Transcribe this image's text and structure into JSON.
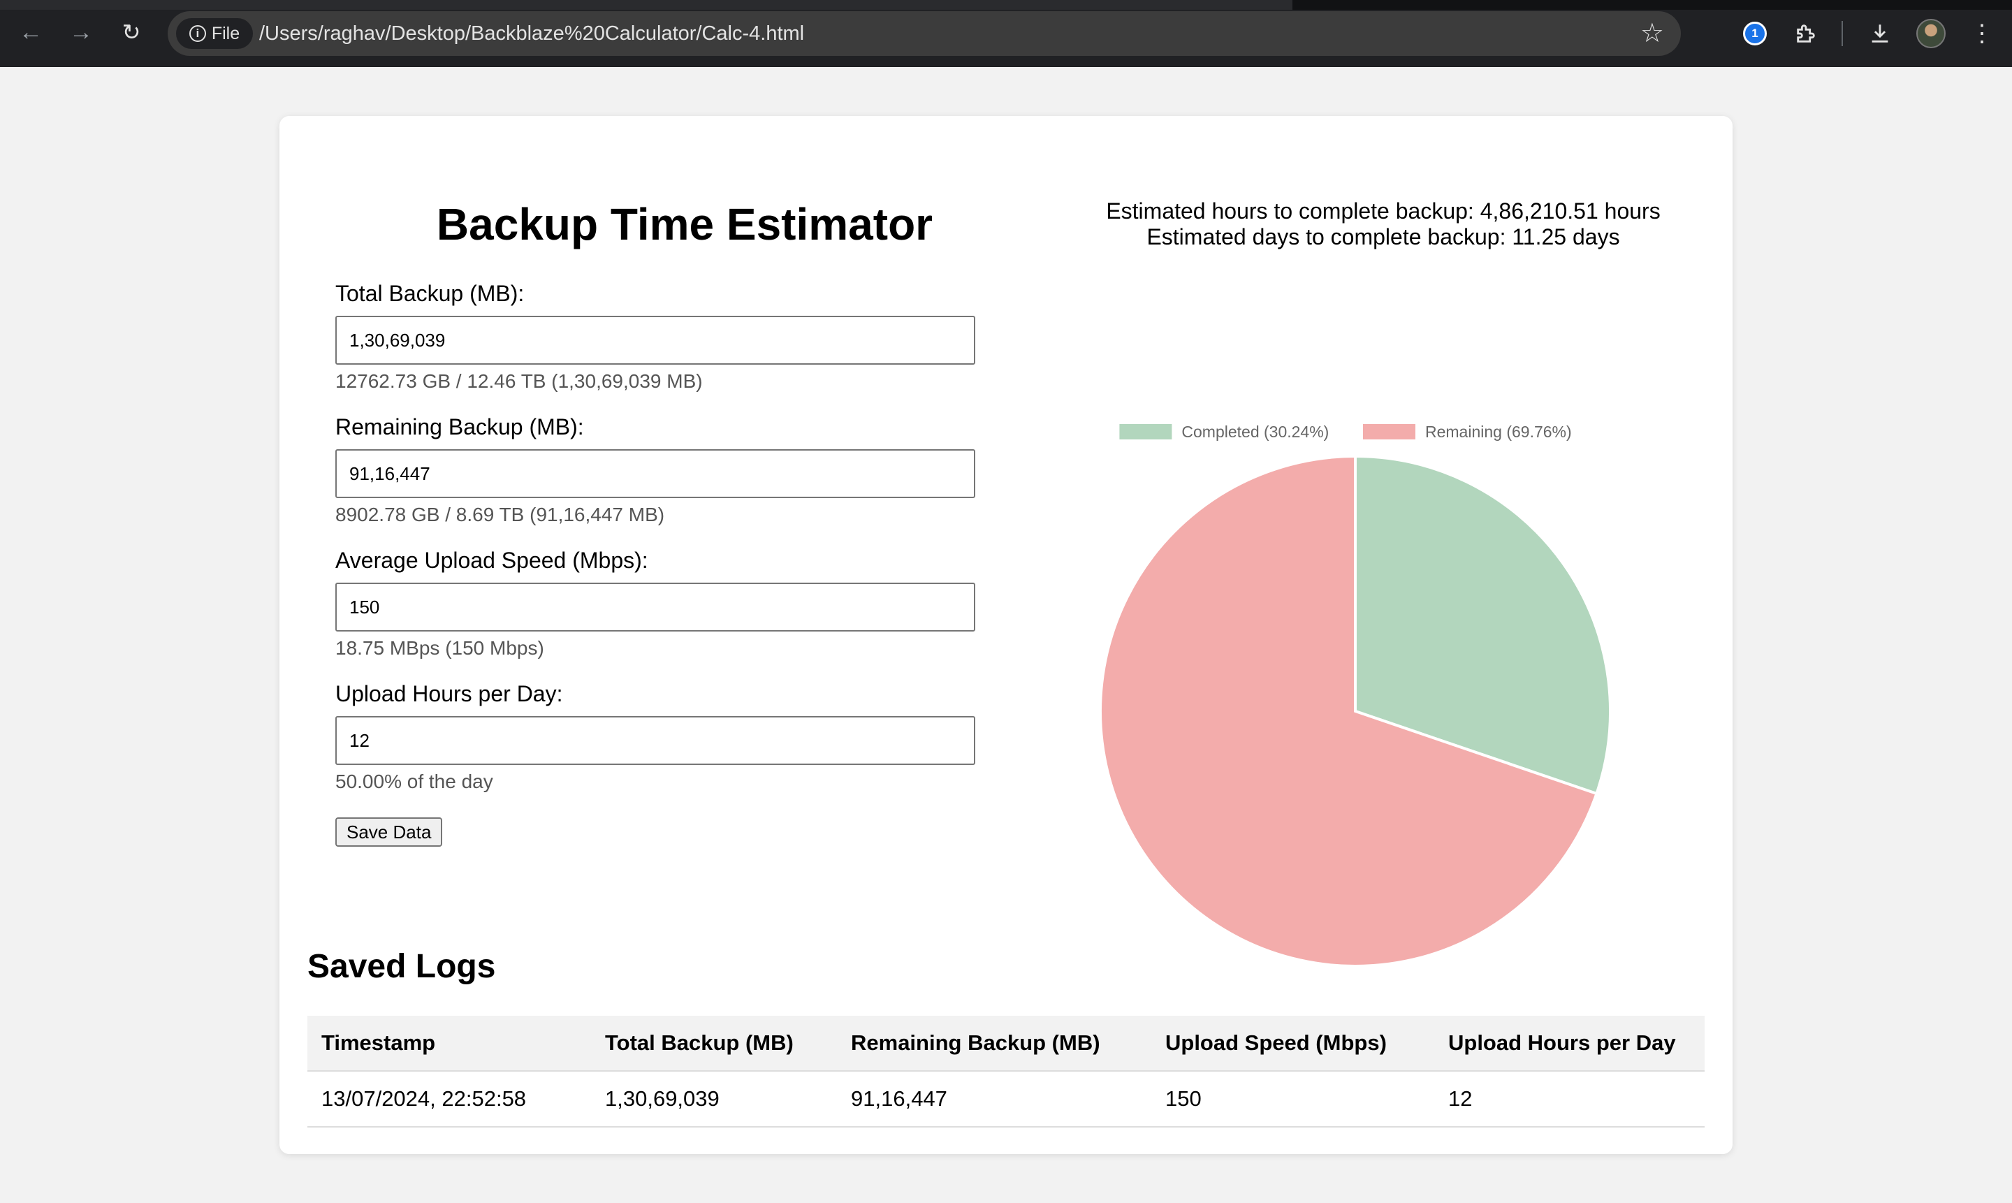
{
  "browser": {
    "file_chip": "File",
    "url": "/Users/raghav/Desktop/Backblaze%20Calculator/Calc-4.html"
  },
  "calculator": {
    "title": "Backup Time Estimator",
    "fields": [
      {
        "label": "Total Backup (MB):",
        "value": "1,30,69,039",
        "hint": "12762.73 GB / 12.46 TB (1,30,69,039 MB)"
      },
      {
        "label": "Remaining Backup (MB):",
        "value": "91,16,447",
        "hint": "8902.78 GB / 8.69 TB (91,16,447 MB)"
      },
      {
        "label": "Average Upload Speed (Mbps):",
        "value": "150",
        "hint": "18.75 MBps (150 Mbps)"
      },
      {
        "label": "Upload Hours per Day:",
        "value": "12",
        "hint": "50.00% of the day"
      }
    ],
    "save_label": "Save Data"
  },
  "estimates": {
    "hours_line": "Estimated hours to complete backup: 4,86,210.51 hours",
    "days_line": "Estimated days to complete backup: 11.25 days"
  },
  "chart_data": {
    "type": "pie",
    "labels": [
      "Completed (30.24%)",
      "Remaining (69.76%)"
    ],
    "values": [
      30.24,
      69.76
    ],
    "colors": [
      "#b2d6bd",
      "#f3acab"
    ],
    "legend": "top"
  },
  "logs": {
    "title": "Saved Logs",
    "columns": [
      "Timestamp",
      "Total Backup (MB)",
      "Remaining Backup (MB)",
      "Upload Speed (Mbps)",
      "Upload Hours per Day"
    ],
    "rows": [
      [
        "13/07/2024, 22:52:58",
        "1,30,69,039",
        "91,16,447",
        "150",
        "12"
      ]
    ]
  }
}
